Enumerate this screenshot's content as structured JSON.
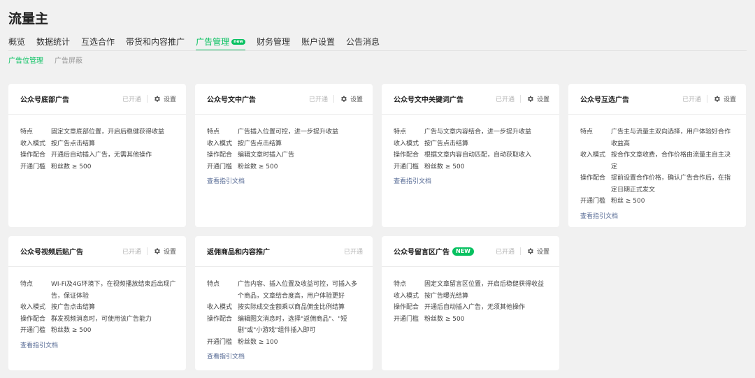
{
  "app": {
    "title": "流量主"
  },
  "nav": {
    "tabs": [
      "概览",
      "数据统计",
      "互选合作",
      "带货和内容推广",
      "广告管理",
      "财务管理",
      "账户设置",
      "公告消息"
    ],
    "active_badge": "new"
  },
  "subnav": [
    "广告位管理",
    "广告屏蔽"
  ],
  "labels": {
    "status": "已开通",
    "setting": "设置",
    "doc_link": "查看指引文档",
    "new_badge": "NEW"
  },
  "cards": [
    {
      "title": "公众号底部广告",
      "rows": [
        {
          "label": "特点",
          "value": "固定文章底部位置，开启后稳健获得收益"
        },
        {
          "label": "收入模式",
          "value": "按广告点击结算"
        },
        {
          "label": "操作配合",
          "value": "开通后自动插入广告，无需其他操作"
        },
        {
          "label": "开通门槛",
          "value": "粉丝数 ≥ 500"
        }
      ]
    },
    {
      "title": "公众号文中广告",
      "rows": [
        {
          "label": "特点",
          "value": "广告插入位置可控，进一步提升收益"
        },
        {
          "label": "收入模式",
          "value": "按广告点击结算"
        },
        {
          "label": "操作配合",
          "value": "编辑文章时插入广告"
        },
        {
          "label": "开通门槛",
          "value": "粉丝数 ≥ 500"
        }
      ]
    },
    {
      "title": "公众号文中关键词广告",
      "rows": [
        {
          "label": "特点",
          "value": "广告与文章内容结合，进一步提升收益"
        },
        {
          "label": "收入模式",
          "value": "按广告点击结算"
        },
        {
          "label": "操作配合",
          "value": "根据文章内容自动匹配，自动获取收入"
        },
        {
          "label": "开通门槛",
          "value": "粉丝数 ≥ 500"
        }
      ]
    },
    {
      "title": "公众号互选广告",
      "rows": [
        {
          "label": "特点",
          "value": "广告主与流量主双向选择，用户体验好合作收益高"
        },
        {
          "label": "收入模式",
          "value": "按合作文章收费，合作价格由流量主自主决定"
        },
        {
          "label": "操作配合",
          "value": "提前设置合作价格，确认广告合作后，在指定日期正式发文"
        },
        {
          "label": "开通门槛",
          "value": "粉丝 ≥ 500"
        }
      ]
    },
    {
      "title": "公众号视频后贴广告",
      "rows": [
        {
          "label": "特点",
          "value": "WI-Fi及4G环境下，在视频播放结束后出现广告，保证体验"
        },
        {
          "label": "收入模式",
          "value": "按广告点击结算"
        },
        {
          "label": "操作配合",
          "value": "群发视频消息时，可使用该广告能力"
        },
        {
          "label": "开通门槛",
          "value": "粉丝数 ≥ 500"
        }
      ]
    },
    {
      "title": "返佣商品和内容推广",
      "rows": [
        {
          "label": "特点",
          "value": "广告内容、插入位置及收益可控，可插入多个商品，文章结合度高，用户体验更好"
        },
        {
          "label": "收入模式",
          "value": "按实际成交金额乘以商品佣金比例结算"
        },
        {
          "label": "操作配合",
          "value": "编辑图文消息时，选择\"返佣商品\"、\"短剧\"或\"小游戏\"组件插入即可"
        },
        {
          "label": "开通门槛",
          "value": "粉丝数 ≥ 100"
        }
      ]
    },
    {
      "title": "公众号留言区广告",
      "rows": [
        {
          "label": "特点",
          "value": "固定文章留言区位置，开启后稳健获得收益"
        },
        {
          "label": "收入模式",
          "value": "按广告曝光结算"
        },
        {
          "label": "操作配合",
          "value": "开通后自动插入广告，无须其他操作"
        },
        {
          "label": "开通门槛",
          "value": "粉丝数 ≥ 500"
        }
      ]
    }
  ],
  "colors": {
    "accent": "#07c160",
    "link": "#576b95"
  }
}
